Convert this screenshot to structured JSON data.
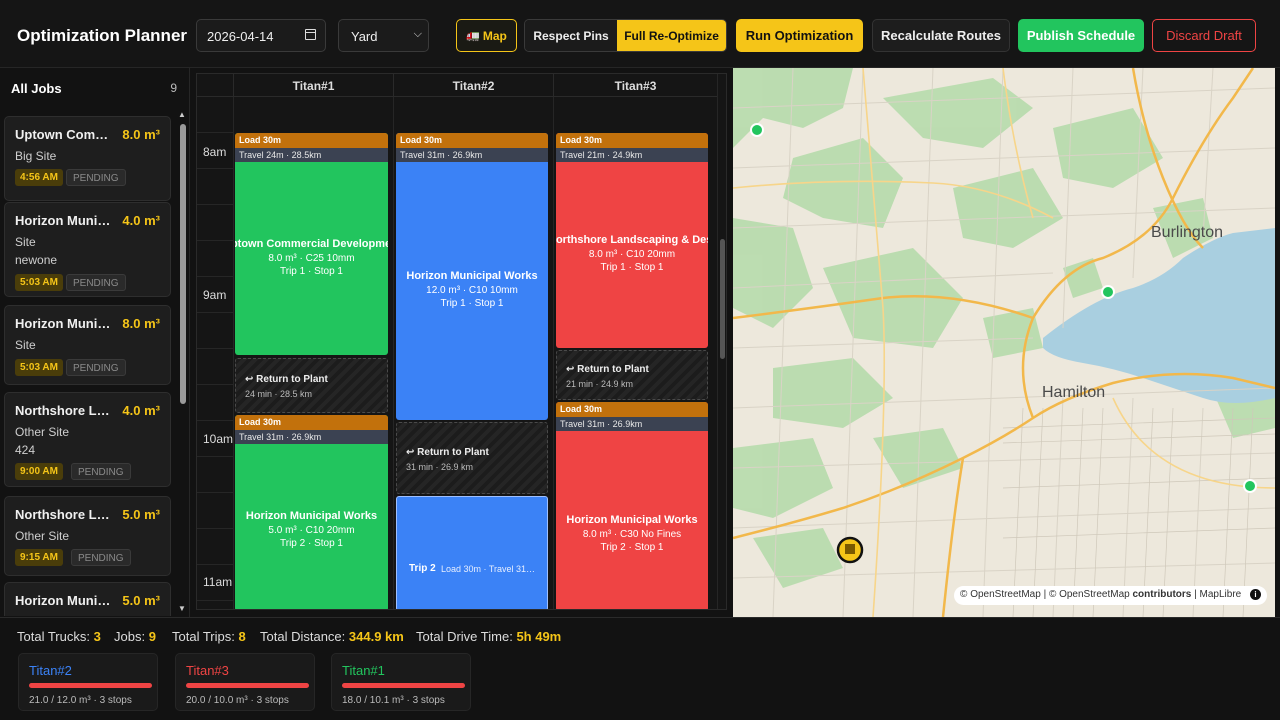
{
  "app": {
    "title": "Optimization Planner"
  },
  "toolbar": {
    "date_value": "2026-04-14",
    "location_select": "Yard",
    "map_label": "Map",
    "respect_pins_label": "Respect Pins",
    "full_reoptimize_label": "Full Re-Optimize",
    "run_label": "Run Optimization",
    "recalc_label": "Recalculate Routes",
    "publish_label": "Publish Schedule",
    "discard_label": "Discard Draft"
  },
  "sidebar": {
    "title": "All Jobs",
    "count": "9",
    "jobs": [
      {
        "name": "Uptown Comme…",
        "volume": "8.0 m³",
        "site": "Big Site",
        "extra": "",
        "time": "4:56 AM",
        "status": "PENDING"
      },
      {
        "name": "Horizon Municip…",
        "volume": "4.0 m³",
        "site": "Site",
        "extra": "newone",
        "time": "5:03 AM",
        "status": "PENDING"
      },
      {
        "name": "Horizon Municip…",
        "volume": "8.0 m³",
        "site": "Site",
        "extra": "",
        "time": "5:03 AM",
        "status": "PENDING"
      },
      {
        "name": "Northshore Lan…",
        "volume": "4.0 m³",
        "site": "Other Site",
        "extra": "424",
        "time": "9:00 AM",
        "status": "PENDING"
      },
      {
        "name": "Northshore Land…",
        "volume": "5.0 m³",
        "site": "Other Site",
        "extra": "",
        "time": "9:15 AM",
        "status": "PENDING"
      },
      {
        "name": "Horizon Municip…",
        "volume": "5.0 m³",
        "site": "",
        "extra": "",
        "time": "",
        "status": ""
      }
    ]
  },
  "schedule": {
    "columns": [
      "Titan#1",
      "Titan#2",
      "Titan#3"
    ],
    "hours": [
      "8am",
      "9am",
      "10am",
      "11am"
    ],
    "blocks": {
      "t1a": {
        "load": "Load 30m",
        "travel": "Travel 24m · 28.5km",
        "title": "Uptown Commercial Development",
        "detail": "8.0 m³ · C25 10mm",
        "trip": "Trip 1 · Stop 1"
      },
      "t1r": {
        "title": "↩ Return to Plant",
        "detail": "24 min · 28.5 km"
      },
      "t1b": {
        "load": "Load 30m",
        "travel": "Travel 31m · 26.9km",
        "title": "Horizon Municipal Works",
        "detail": "5.0 m³ · C10 20mm",
        "trip": "Trip 2 · Stop 1"
      },
      "t2a": {
        "load": "Load 30m",
        "travel": "Travel 31m · 26.9km",
        "title": "Horizon Municipal Works",
        "detail": "12.0 m³ · C10 10mm",
        "trip": "Trip 1 · Stop 1"
      },
      "t2r": {
        "title": "↩ Return to Plant",
        "detail": "31 min · 26.9 km"
      },
      "t2b": {
        "title": "Trip 2",
        "detail": "Load 30m · Travel 31…"
      },
      "t3a": {
        "load": "Load 30m",
        "travel": "Travel 21m · 24.9km",
        "title": "Northshore Landscaping & Design",
        "detail": "8.0 m³ · C10 20mm",
        "trip": "Trip 1 · Stop 1"
      },
      "t3r": {
        "title": "↩ Return to Plant",
        "detail": "21 min · 24.9 km"
      },
      "t3b": {
        "load": "Load 30m",
        "travel": "Travel 31m · 26.9km",
        "title": "Horizon Municipal Works",
        "detail": "8.0 m³ · C30 No Fines",
        "trip": "Trip 2 · Stop 1"
      }
    }
  },
  "map": {
    "labels": {
      "burlington": "Burlington",
      "hamilton": "Hamilton"
    },
    "attribution_pre": "© OpenStreetMap | © OpenStreetMap",
    "attribution_bold": "contributors",
    "attribution_post": "| MapLibre"
  },
  "footer": {
    "stats": [
      {
        "label": "Total Trucks:",
        "value": "3"
      },
      {
        "label": "Jobs:",
        "value": "9"
      },
      {
        "label": "Total Trips:",
        "value": "8"
      },
      {
        "label": "Total Distance:",
        "value": "344.9 km"
      },
      {
        "label": "Total Drive Time:",
        "value": "5h 49m"
      }
    ],
    "trucks": [
      {
        "name": "Titan#2",
        "color": "#3b82f6",
        "capacity": "21.0 / 12.0 m³ · 3 stops"
      },
      {
        "name": "Titan#3",
        "color": "#ef4444",
        "capacity": "20.0 / 10.0 m³ · 3 stops"
      },
      {
        "name": "Titan#1",
        "color": "#22c55e",
        "capacity": "18.0 / 10.1 m³ · 3 stops"
      }
    ]
  },
  "colors": {
    "accent": "#f5c518",
    "green": "#22c55e",
    "blue": "#3b82f6",
    "red": "#ef4444",
    "load": "#c2710c"
  },
  "icons": [
    "calendar-icon",
    "chevron-down-icon",
    "truck-icon",
    "return-icon",
    "info-icon",
    "plant-marker-icon"
  ]
}
